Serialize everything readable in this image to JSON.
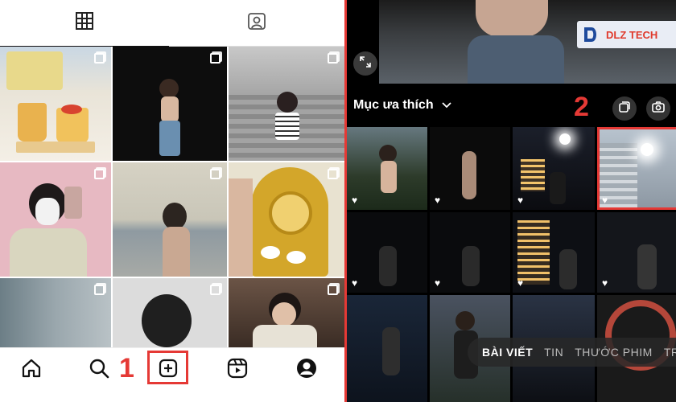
{
  "left_panel": {
    "tabs": [
      {
        "icon": "grid-icon",
        "active": true
      },
      {
        "icon": "tagged-person-icon",
        "active": false
      }
    ],
    "nav": [
      {
        "icon": "home-icon"
      },
      {
        "icon": "search-icon"
      },
      {
        "icon": "create-post-icon"
      },
      {
        "icon": "reels-icon"
      },
      {
        "icon": "profile-icon"
      }
    ],
    "step_number": "1"
  },
  "right_panel": {
    "logo": {
      "text": "DLZ TECH"
    },
    "gallery_title": "Mục ưa thích",
    "step_number": "2",
    "modes": {
      "post": "BÀI VIẾT",
      "story": "TIN",
      "reel": "THƯỚC PHIM",
      "live": "TR"
    }
  },
  "colors": {
    "highlight": "#e53935",
    "dark_bg": "#000000"
  }
}
